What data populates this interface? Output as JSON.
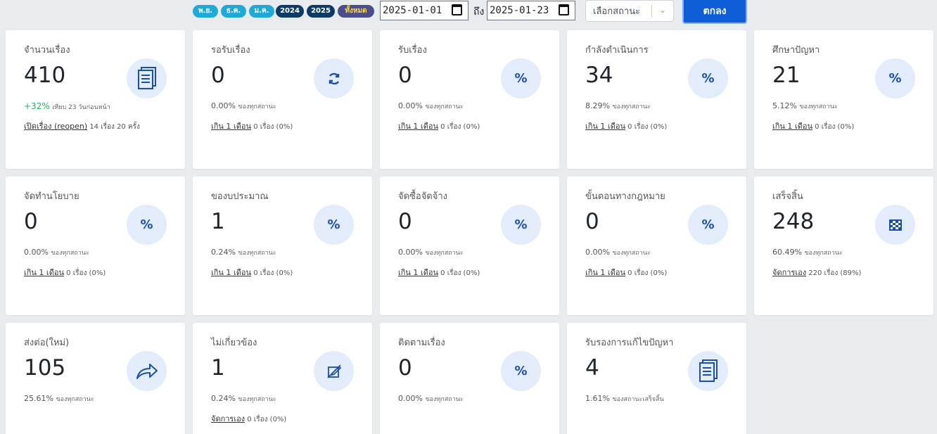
{
  "toolbar": {
    "pills": [
      {
        "label": "พ.ย.",
        "style": "light"
      },
      {
        "label": "ธ.ค.",
        "style": "light"
      },
      {
        "label": "ม.ค.",
        "style": "light"
      },
      {
        "label": "2024",
        "style": "dark"
      },
      {
        "label": "2025",
        "style": "dark"
      },
      {
        "label": "ทั้งหมด",
        "style": "all"
      }
    ],
    "date_from": "2025-01-01",
    "to_label": "ถึง",
    "date_to": "2025-01-23",
    "status_placeholder": "เลือกสถานะ",
    "ok_label": "ตกลง"
  },
  "cards": [
    {
      "title": "จำนวนเรื่อง",
      "value": "410",
      "icon": "documents-icon",
      "growth": "+32%",
      "sub_text": "เทียบ 23 วันก่อนหน้า",
      "link": "เปิดเรื่อง (reopen)",
      "link_text": "14 เรื่อง 20 ครั้ง"
    },
    {
      "title": "รอรับเรื่อง",
      "value": "0",
      "icon": "refresh-icon",
      "pct": "0.00%",
      "sub_text": "ของทุกสถานะ",
      "link": "เกิน 1 เดือน",
      "link_text": "0 เรื่อง (0%)"
    },
    {
      "title": "รับเรื่อง",
      "value": "0",
      "icon": "percent-icon",
      "pct": "0.00%",
      "sub_text": "ของทุกสถานะ",
      "link": "เกิน 1 เดือน",
      "link_text": "0 เรื่อง (0%)"
    },
    {
      "title": "กำลังดำเนินการ",
      "value": "34",
      "icon": "percent-icon",
      "pct": "8.29%",
      "sub_text": "ของทุกสถานะ",
      "link": "เกิน 1 เดือน",
      "link_text": "0 เรื่อง (0%)"
    },
    {
      "title": "ศึกษาปัญหา",
      "value": "21",
      "icon": "percent-icon",
      "pct": "5.12%",
      "sub_text": "ของทุกสถานะ",
      "link": "เกิน 1 เดือน",
      "link_text": "0 เรื่อง (0%)"
    },
    {
      "title": "จัดทำนโยบาย",
      "value": "0",
      "icon": "percent-icon",
      "pct": "0.00%",
      "sub_text": "ของทุกสถานะ",
      "link": "เกิน 1 เดือน",
      "link_text": "0 เรื่อง (0%)"
    },
    {
      "title": "ของบประมาณ",
      "value": "1",
      "icon": "percent-icon",
      "pct": "0.24%",
      "sub_text": "ของทุกสถานะ",
      "link": "เกิน 1 เดือน",
      "link_text": "0 เรื่อง (0%)"
    },
    {
      "title": "จัดซื้อจัดจ้าง",
      "value": "0",
      "icon": "percent-icon",
      "pct": "0.00%",
      "sub_text": "ของทุกสถานะ",
      "link": "เกิน 1 เดือน",
      "link_text": "0 เรื่อง (0%)"
    },
    {
      "title": "ขั้นตอนทางกฎหมาย",
      "value": "0",
      "icon": "percent-icon",
      "pct": "0.00%",
      "sub_text": "ของทุกสถานะ",
      "link": "เกิน 1 เดือน",
      "link_text": "0 เรื่อง (0%)"
    },
    {
      "title": "เสร็จสิ้น",
      "value": "248",
      "icon": "checkered-flag-icon",
      "pct": "60.49%",
      "sub_text": "ของทุกสถานะ",
      "link": "จัดการเอง",
      "link_text": "220 เรื่อง (89%)"
    },
    {
      "title": "ส่งต่อ(ใหม่)",
      "value": "105",
      "icon": "share-arrow-icon",
      "pct": "25.61%",
      "sub_text": "ของทุกสถานะ"
    },
    {
      "title": "ไม่เกี่ยวข้อง",
      "value": "1",
      "icon": "crossed-edit-icon",
      "pct": "0.24%",
      "sub_text": "ของทุกสถานะ",
      "link": "จัดการเอง",
      "link_text": "0 เรื่อง (0%)"
    },
    {
      "title": "ติดตามเรื่อง",
      "value": "0",
      "icon": "percent-icon",
      "pct": "0.00%",
      "sub_text": "ของทุกสถานะ"
    },
    {
      "title": "รับรองการแก้ไขปัญหา",
      "value": "4",
      "icon": "documents-icon",
      "pct": "1.61%",
      "sub_text": "ของสถานะเสร็จสิ้น"
    }
  ],
  "colors": {
    "accent": "#0d5ed7",
    "icon_bg": "#e3ecfb",
    "icon_fg": "#1b4fa8",
    "growth": "#27ae60",
    "background": "#e9ecef"
  }
}
